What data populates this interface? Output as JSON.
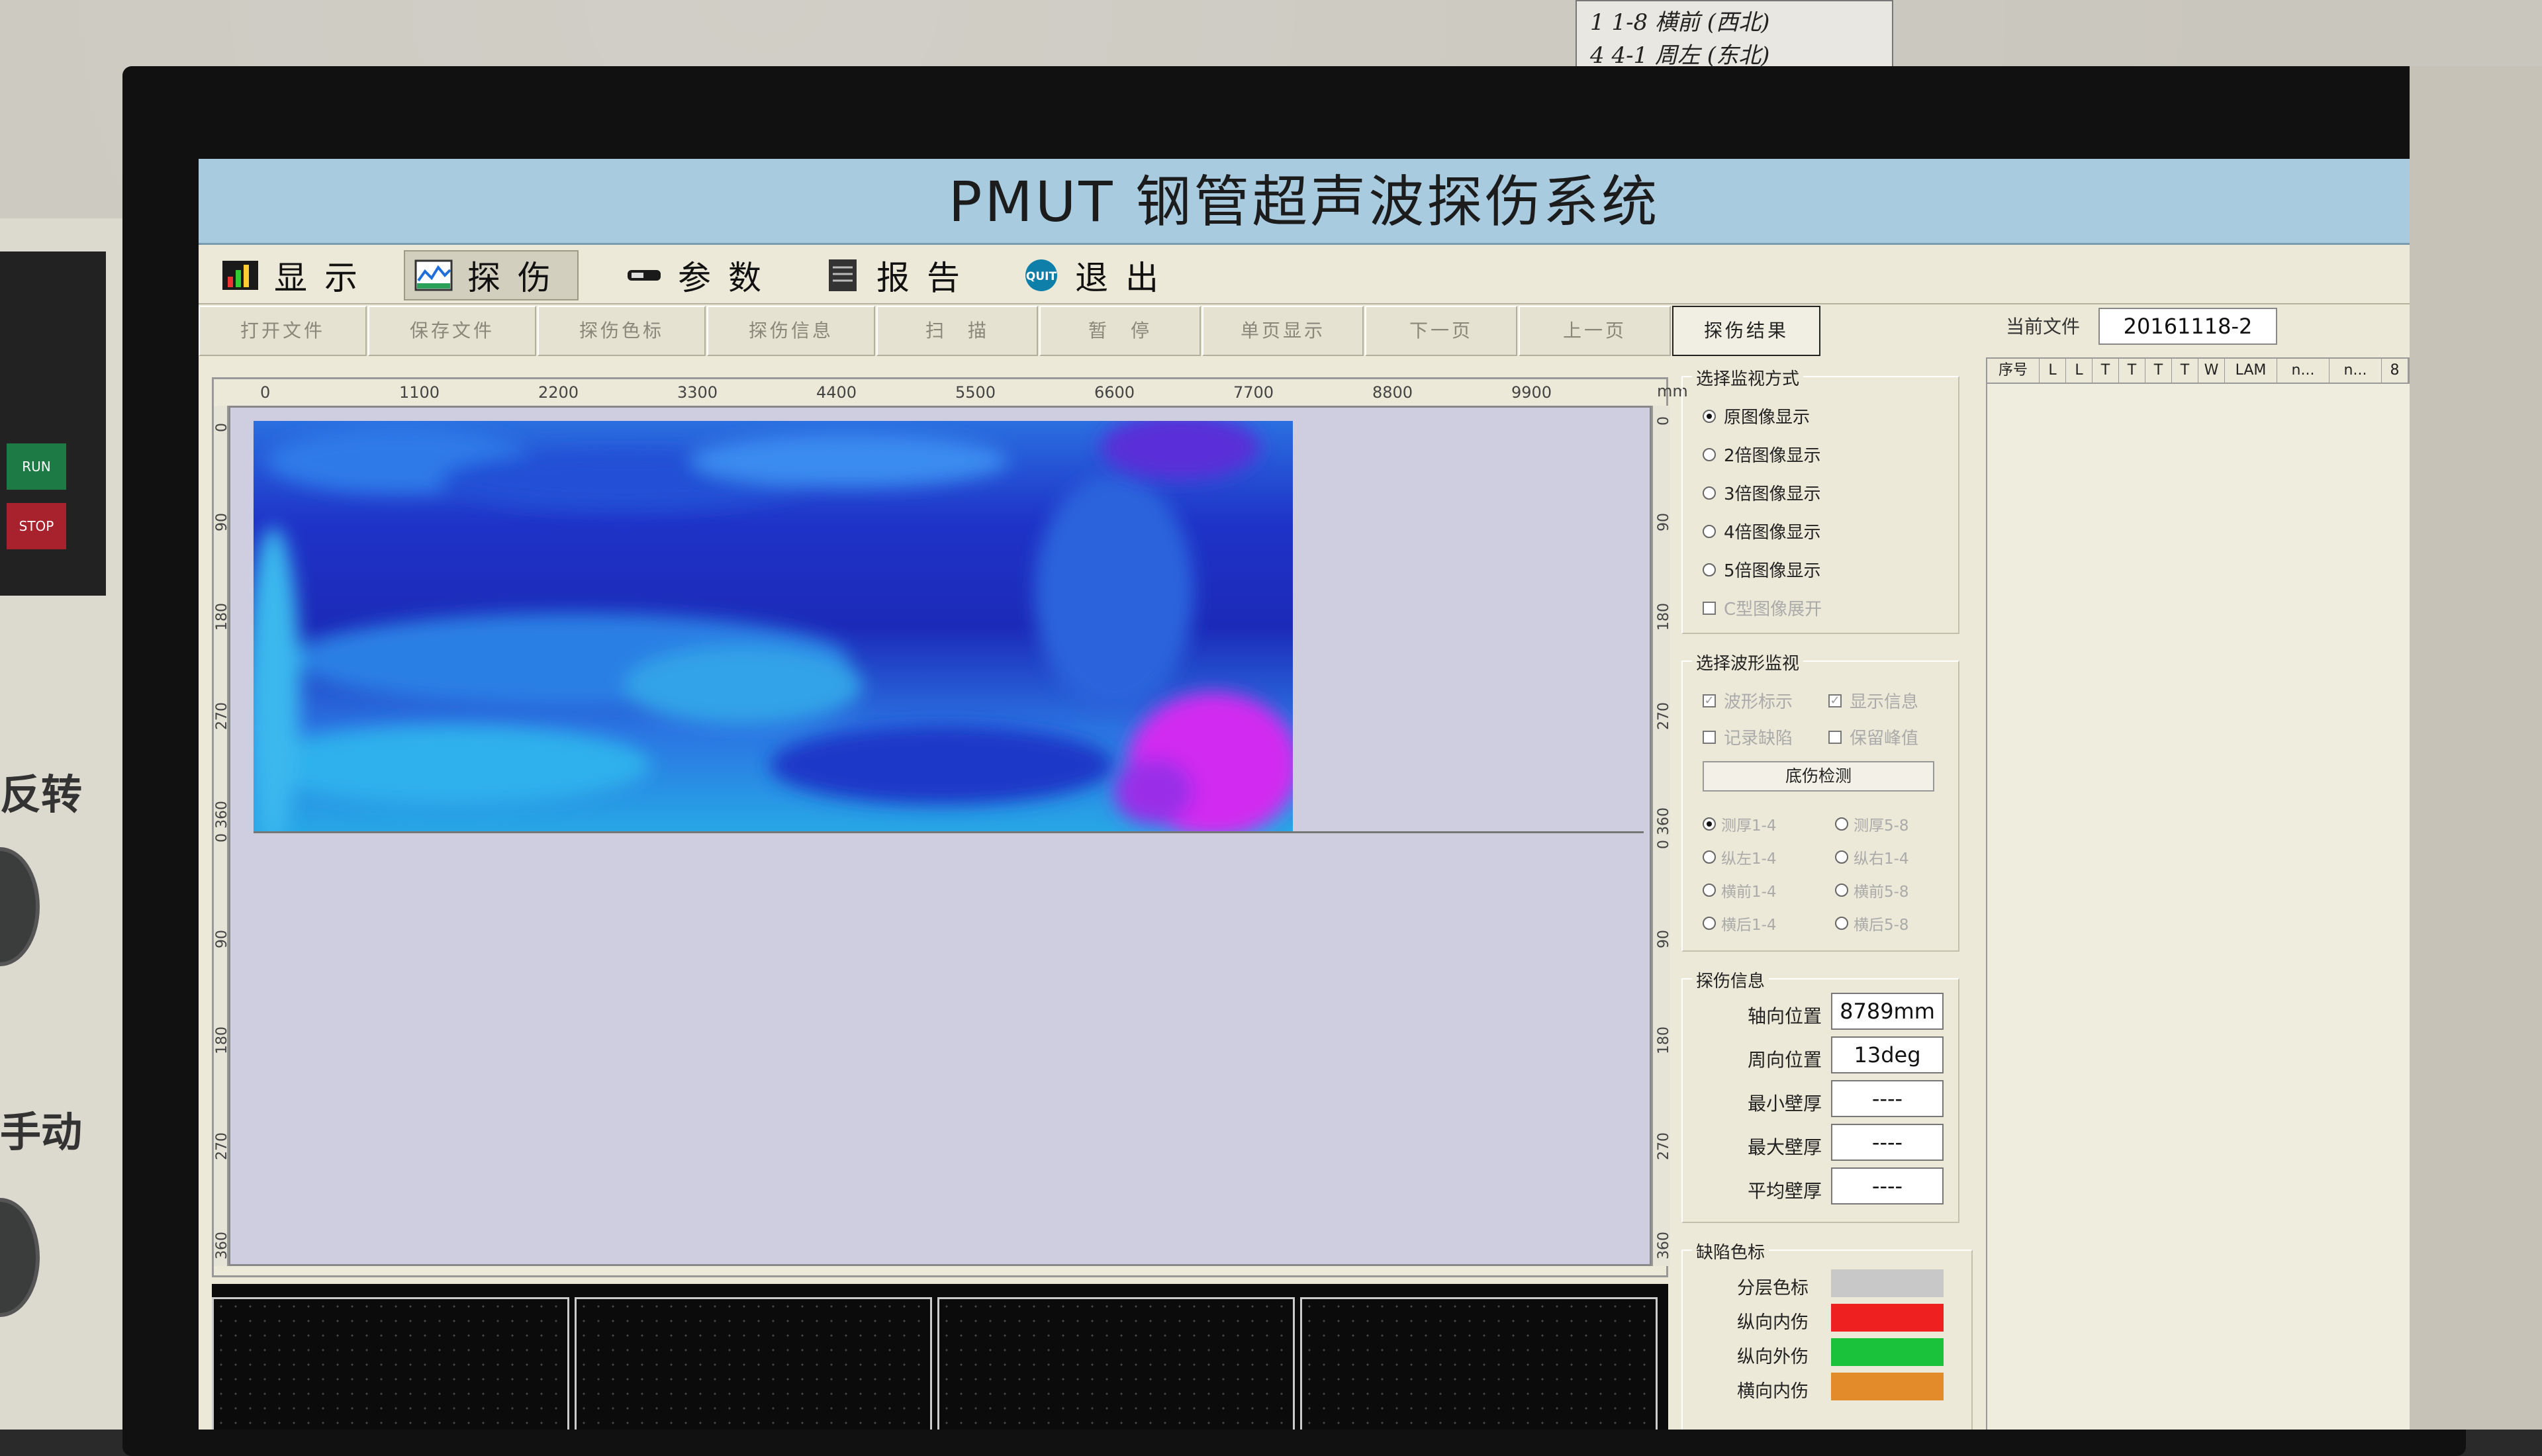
{
  "app": {
    "title": "PMUT 钢管超声波探伤系统"
  },
  "wall_note": {
    "rows": [
      "1   1-8   横前 (西北)",
      "4   4-1   周左 (东北)"
    ]
  },
  "side_panel": {
    "labels": [
      "反转",
      "手动"
    ],
    "buttons": [
      "RUN",
      "STOP"
    ]
  },
  "menu": [
    {
      "label": "显示",
      "icon": "chart-icon"
    },
    {
      "label": "探伤",
      "icon": "scan-icon"
    },
    {
      "label": "参数",
      "icon": "parameter-icon"
    },
    {
      "label": "报告",
      "icon": "report-icon"
    },
    {
      "label": "退出",
      "icon": "quit-icon",
      "icon_text": "QUIT"
    }
  ],
  "toolbar": [
    "打开文件",
    "保存文件",
    "探伤色标",
    "探伤信息",
    "扫　描",
    "暂　停",
    "单页显示",
    "下一页",
    "上一页",
    "探伤结果"
  ],
  "current_file": {
    "label": "当前文件",
    "value": "20161118-2"
  },
  "viewer": {
    "x_ticks": [
      "0",
      "1100",
      "2200",
      "3300",
      "4400",
      "5500",
      "6600",
      "7700",
      "8800",
      "9900"
    ],
    "x_unit": "mm",
    "left_y_ticks": [
      "0",
      "90",
      "180",
      "270",
      "0 360",
      "90",
      "180",
      "270",
      "360"
    ],
    "right_y_ticks": [
      "0",
      "90",
      "180",
      "270",
      "0 360",
      "90",
      "180",
      "270",
      "360"
    ],
    "colors": {
      "scan_dark": "#1f2fc4",
      "scan_mid": "#2f6fe6",
      "scan_light": "#2bb6e8",
      "defect": "#d22bf0",
      "empty": "#cfcde0"
    }
  },
  "monitor_mode": {
    "title": "选择监视方式",
    "options": [
      "原图像显示",
      "2倍图像显示",
      "3倍图像显示",
      "4倍图像显示",
      "5倍图像显示"
    ],
    "selected": 0,
    "checkbox": "C型图像展开"
  },
  "wave_monitor": {
    "title": "选择波形监视",
    "checks": [
      {
        "label": "波形标示",
        "checked": true
      },
      {
        "label": "显示信息",
        "checked": true
      },
      {
        "label": "记录缺陷",
        "checked": false
      },
      {
        "label": "保留峰值",
        "checked": false
      }
    ],
    "button": "底伤检测",
    "channels": [
      "测厚1-4",
      "测厚5-8",
      "纵左1-4",
      "纵右1-4",
      "横前1-4",
      "横前5-8",
      "横后1-4",
      "横后5-8"
    ]
  },
  "flaw_info": {
    "title": "探伤信息",
    "rows": [
      {
        "label": "轴向位置",
        "value": "8789mm"
      },
      {
        "label": "周向位置",
        "value": "13deg"
      },
      {
        "label": "最小壁厚",
        "value": "----"
      },
      {
        "label": "最大壁厚",
        "value": "----"
      },
      {
        "label": "平均壁厚",
        "value": "----"
      }
    ]
  },
  "defect_colors": {
    "title": "缺陷色标",
    "rows": [
      {
        "label": "分层色标",
        "color": "#c8c8c8"
      },
      {
        "label": "纵向内伤",
        "color": "#ee2020"
      },
      {
        "label": "纵向外伤",
        "color": "#19c23a"
      },
      {
        "label": "横向内伤",
        "color": "#e38a2a"
      }
    ]
  },
  "results_table": {
    "columns": [
      "序号",
      "L",
      "L",
      "T",
      "T",
      "T",
      "T",
      "W",
      "LAM",
      "n...",
      "n...",
      "8"
    ]
  }
}
